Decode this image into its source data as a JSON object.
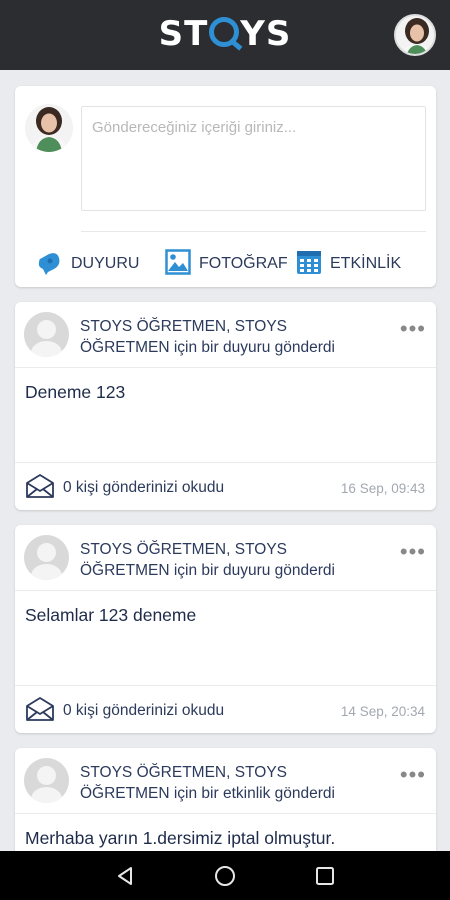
{
  "header": {
    "logo_text_left": "ST",
    "logo_text_right": "YS",
    "logo_letter_o": "O",
    "brand_color": "#2f8fd4"
  },
  "composer": {
    "placeholder": "Göndereceğiniz içeriği giriniz...",
    "actions": [
      {
        "label": "DUYURU",
        "icon": "megaphone-icon"
      },
      {
        "label": "FOTOĞRAF",
        "icon": "image-icon"
      },
      {
        "label": "ETKİNLİK",
        "icon": "calendar-icon"
      }
    ]
  },
  "posts": [
    {
      "author": "STOYS ÖĞRETMEN, STOYS ÖĞRETMEN için bir duyuru gönderdi",
      "content": "Deneme 123",
      "reads": "0 kişi gönderinizi okudu",
      "time": "16 Sep, 09:43"
    },
    {
      "author": "STOYS ÖĞRETMEN, STOYS ÖĞRETMEN için bir duyuru gönderdi",
      "content": "Selamlar 123 deneme",
      "reads": "0 kişi gönderinizi okudu",
      "time": "14 Sep, 20:34"
    },
    {
      "author": "STOYS ÖĞRETMEN, STOYS ÖĞRETMEN için bir etkinlik gönderdi",
      "content": "Merhaba yarın 1.dersimiz iptal olmuştur."
    }
  ],
  "more_icon_text": "•••"
}
